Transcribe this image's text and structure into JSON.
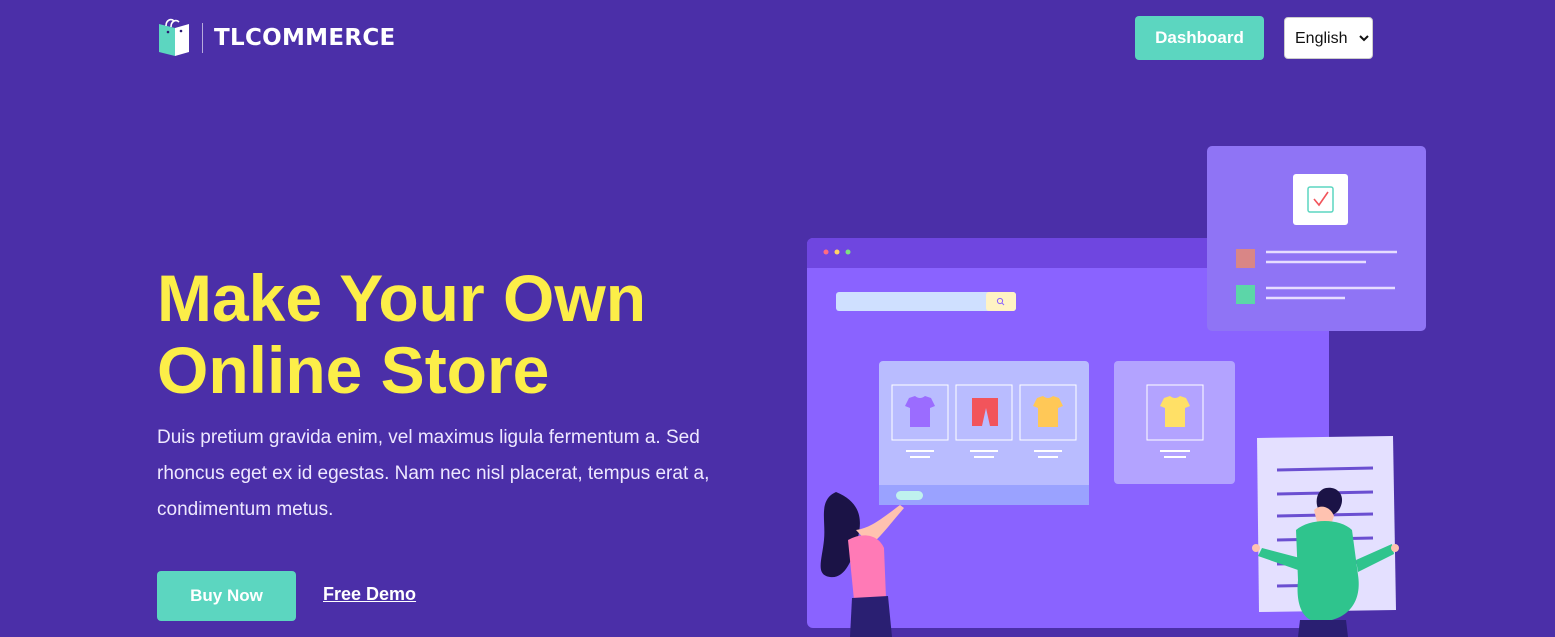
{
  "header": {
    "logo_text": "TLCOMMERCE",
    "dashboard_label": "Dashboard",
    "language": {
      "selected": "English",
      "options": [
        "English"
      ]
    }
  },
  "hero": {
    "title_line1": "Make Your Own",
    "title_line2": "Online Store",
    "description": "Duis pretium gravida enim, vel maximus ligula fermentum a. Sed rhoncus eget ex id egestas. Nam nec nisl placerat, tempus erat a, condimentum metus.",
    "buy_label": "Buy Now",
    "demo_label": "Free Demo"
  },
  "colors": {
    "background": "#4b2fa8",
    "accent": "#5cd6c0",
    "title": "#fcee48"
  },
  "icons": [
    "shopping-bag-logo-icon",
    "cart-icon",
    "checkbox-icon",
    "search-icon",
    "tshirt-icon",
    "shorts-icon"
  ]
}
